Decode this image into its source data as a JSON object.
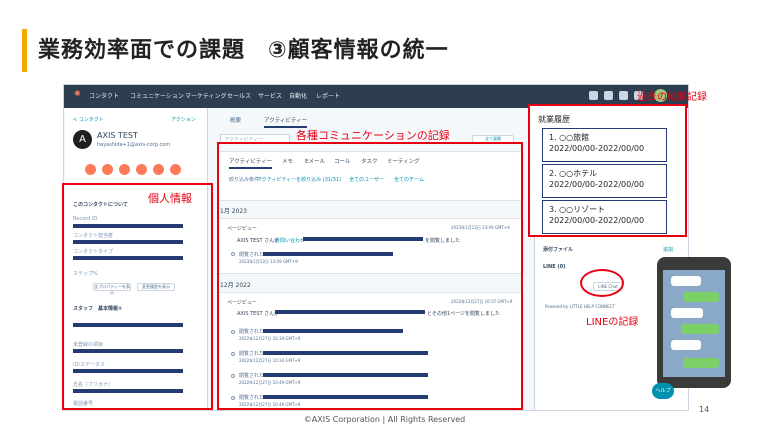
{
  "slide": {
    "title": "業務効率面での課題　③顧客情報の統一",
    "footer": "©AXIS Corporation | All Rights Reserved",
    "page_number": "14"
  },
  "annotations": {
    "personal_info": "個人情報",
    "communication_records": "各種コミュニケーションの記録",
    "past_jobs": "過去の就業記録",
    "line_records": "LINEの記録"
  },
  "crm": {
    "nav_items": [
      "コンタクト",
      "コミュニケーション",
      "マーケティング",
      "セールス",
      "サービス",
      "自動化",
      "レポート"
    ],
    "back_link": "< コンタクト",
    "actions_label": "アクション",
    "contact_name": "AXIS TEST",
    "contact_email": "hayashida+1@axis-corp.com",
    "about_header": "このコンタクトについて",
    "fields": [
      "Record ID",
      "コンタクト担当者",
      "コンタクトタイプ",
      "ステップ%"
    ],
    "btn_view_all": "全プロパティーを表示",
    "btn_history": "変更履歴を表示",
    "staff_header": "スタッフ　基本情報①",
    "staff_fields": [
      "未登録の項目",
      "ID/ステータス",
      "氏名（フリガナ）",
      "電話番号"
    ],
    "top_tabs": [
      "概要",
      "アクティビティー"
    ],
    "search_placeholder": "アクティビティー",
    "collapse_all": "全て展開",
    "activity_tabs": [
      "アクティビティー",
      "メモ",
      "Eメール",
      "コール",
      "タスク",
      "ミーティング"
    ],
    "filter_label": "絞り込み条件：",
    "filter_value": "アクティビティーを絞り込み (31/31)",
    "filter_users": "全てのユーザー",
    "filter_teams": "全てのチーム",
    "months": [
      "1月 2023",
      "12月 2022"
    ],
    "page_view_label": "ページビュー",
    "timestamps": [
      "2023年1月13日 13:09 GMT+9",
      "2022年12月27日 10:37 GMT+9"
    ],
    "entry1_prefix": "AXIS TEST さんが",
    "entry1_link": "お問い合わせ",
    "entry1_suffix": "を閲覧しました",
    "entry2_prefix": "AXIS TEST さんが",
    "entry2_suffix": "とその他1ページを閲覧しました",
    "visit_label": "閲覧された",
    "sub_times": [
      "2023年1月13日 13:09 GMT+9",
      "2022年12月27日 10:34 GMT+9",
      "2022年12月27日 10:34 GMT+9",
      "2022年12月27日 10:49 GMT+9",
      "2022年12月27日 10:49 GMT+9"
    ],
    "history_title": "就業履歴",
    "history": [
      {
        "name": "1. ○○旅館",
        "period": "2022/00/00-2022/00/00"
      },
      {
        "name": "2. ○○ホテル",
        "period": "2022/00/00-2022/00/00"
      },
      {
        "name": "3. ○○リゾート",
        "period": "2022/00/00-2022/00/00"
      }
    ],
    "attachments_label": "添付ファイル",
    "attachments_action": "追加",
    "line_label": "LINE (0)",
    "line_chat_btn": "LINE Chat",
    "powered_by": "Powered by LITTLE HELP CONNECT",
    "help_label": "ヘルプ"
  },
  "colors": {
    "accent": "#f5a800",
    "nav": "#2d3e50",
    "highlight": "#e60012",
    "redact": "#253c72",
    "orange": "#ff7a59"
  }
}
